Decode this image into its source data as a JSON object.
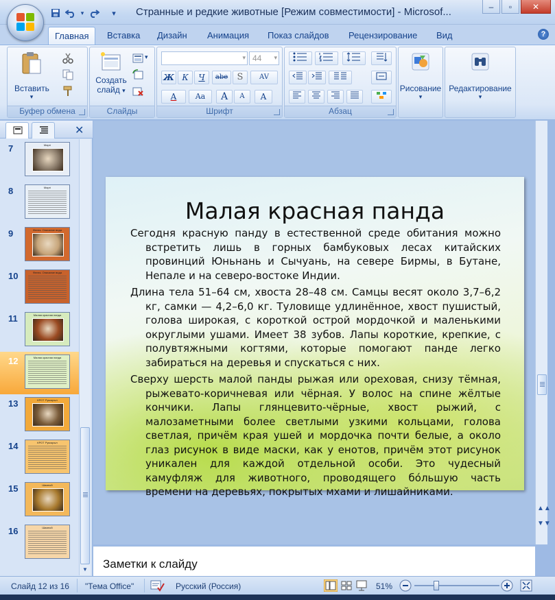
{
  "window": {
    "title": "Странные и редкие животные [Режим совместимости] - Microsof...",
    "minimize": "–",
    "restore": "▫",
    "close": "✕"
  },
  "qat": {
    "customize": "▾"
  },
  "tabs": [
    {
      "label": "Главная"
    },
    {
      "label": "Вставка"
    },
    {
      "label": "Дизайн"
    },
    {
      "label": "Анимация"
    },
    {
      "label": "Показ слайдов"
    },
    {
      "label": "Рецензирование"
    },
    {
      "label": "Вид"
    }
  ],
  "help": "?",
  "ribbon": {
    "clipboard": {
      "label": "Буфер обмена",
      "paste": "Вставить"
    },
    "slides": {
      "label": "Слайды",
      "create_line1": "Создать",
      "create_line2": "слайд"
    },
    "font": {
      "label": "Шрифт",
      "size": "44",
      "bold": "Ж",
      "italic": "К",
      "underline": "Ч",
      "strike": "abe",
      "shadow": "S",
      "spacing": "AV",
      "font_color": "A",
      "case": "Aa",
      "grow": "A",
      "shrink": "A",
      "clear": "A"
    },
    "paragraph": {
      "label": "Абзац"
    },
    "drawing": {
      "label": "Рисование"
    },
    "editing": {
      "label": "Редактирование"
    }
  },
  "pane": {
    "close": "✕"
  },
  "slides": [
    {
      "num": "7",
      "title": "Маргі",
      "bg": "#e8eef6",
      "pic": "#8a7b6a"
    },
    {
      "num": "8",
      "title": "Маргі",
      "bg": "#e9f0f7",
      "pic": ""
    },
    {
      "num": "9",
      "title": "Фенек. Описание вида",
      "bg": "#d2692e",
      "pic": "#c7a57a"
    },
    {
      "num": "10",
      "title": "Фенек. Описание вида",
      "bg": "#c8622c",
      "pic": ""
    },
    {
      "num": "11",
      "title": "Малая красная панда",
      "bg": "#d6ebbd",
      "pic": "#9a4a22"
    },
    {
      "num": "12",
      "title": "Малая красная панда",
      "bg": "#dff0c5",
      "pic": ""
    },
    {
      "num": "13",
      "title": "КРОТ Рукокрыл",
      "bg": "#f2a93a",
      "pic": "#7a5c3a"
    },
    {
      "num": "14",
      "title": "КРОТ Рукокрыл",
      "bg": "#f7c46e",
      "pic": ""
    },
    {
      "num": "15",
      "title": "Шимпой",
      "bg": "#f3b85a",
      "pic": "#a87a2e"
    },
    {
      "num": "16",
      "title": "Шимпой",
      "bg": "#f6d6a8",
      "pic": ""
    }
  ],
  "slide": {
    "title": "Малая красная панда",
    "paragraphs": [
      "Сегодня красную панду в естественной среде обитания можно встретить лишь в горных бамбуковых лесах китайских провинций Юньнань и Сычуань, на севере Бирмы, в Бутане, Непале и на северо-востоке Индии.",
      "Длина тела 51–64 см, хвоста 28–48 см. Самцы весят около 3,7–6,2 кг, самки — 4,2–6,0 кг. Туловище удлинённое, хвост пушистый, голова широкая, с короткой острой мордочкой и маленькими округлыми ушами. Имеет 38 зубов. Лапы короткие, крепкие, с полувтяжными когтями, которые помогают панде легко забираться на деревья и спускаться с них.",
      "Сверху шерсть малой панды рыжая или ореховая, снизу тёмная, рыжевато-коричневая или чёрная. У волос на спине жёлтые кончики. Лапы глянцевито-чёрные, хвост рыжий, с малозаметными более светлыми узкими кольцами, голова светлая, причём края ушей и мордочка почти белые, а около глаз рисунок в виде маски, как у енотов, причём этот рисунок уникален для каждой отдельной особи. Это чудесный камуфляж для животного, проводящего бо́льшую часть времени на деревьях, покрытых мхами и лишайниками."
    ]
  },
  "notes": {
    "placeholder": "Заметки к слайду"
  },
  "status": {
    "slide_counter": "Слайд 12 из 16",
    "theme": "\"Тема Office\"",
    "language": "Русский (Россия)",
    "zoom": "51%",
    "zoom_level": 0.51
  },
  "colors": {
    "accent": "#15428b",
    "selected": "#f8a83a"
  }
}
